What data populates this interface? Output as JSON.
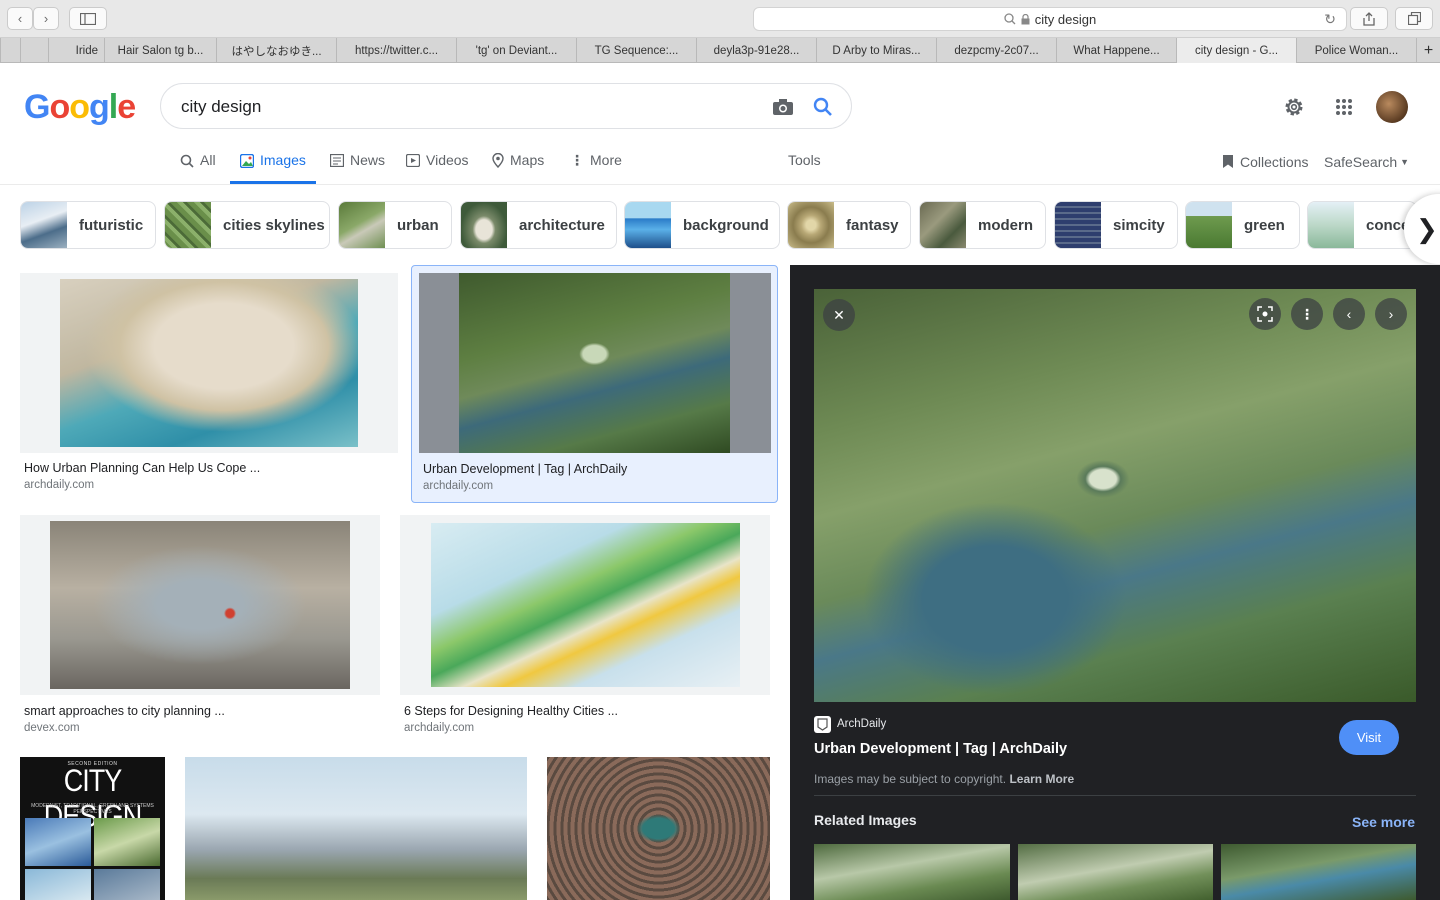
{
  "browser": {
    "address": "city design",
    "tabs": [
      "Iride",
      "Hair Salon tg b...",
      "はやしなおゆき...",
      "https://twitter.c...",
      "'tg' on Deviant...",
      "TG Sequence:...",
      "deyla3p-91e28...",
      "D Arby to Miras...",
      "dezpcmy-2c07...",
      "What Happene...",
      "city design - G...",
      "Police Woman..."
    ],
    "active_tab": 10
  },
  "search": {
    "query": "city design"
  },
  "nav": {
    "tabs": [
      "All",
      "Images",
      "News",
      "Videos",
      "Maps",
      "More"
    ],
    "tools": "Tools",
    "collections": "Collections",
    "safesearch": "SafeSearch"
  },
  "chips": [
    "futuristic",
    "cities skylines",
    "urban",
    "architecture",
    "background",
    "fantasy",
    "modern",
    "simcity",
    "green",
    "conce"
  ],
  "results": [
    {
      "caption": "How Urban Planning Can Help Us Cope ...",
      "source": "archdaily.com"
    },
    {
      "caption": "Urban Development | Tag | ArchDaily",
      "source": "archdaily.com"
    },
    {
      "caption": "smart approaches to city planning ...",
      "source": "devex.com"
    },
    {
      "caption": "6 Steps for Designing Healthy Cities ...",
      "source": "archdaily.com"
    }
  ],
  "book": {
    "edition": "SECOND EDITION",
    "title": "CITY DESIGN",
    "subtitle": "MODERNIST, TRADITIONAL, GREEN AND SYSTEMS PERSPECTIVES"
  },
  "panel": {
    "site": "ArchDaily",
    "title": "Urban Development | Tag | ArchDaily",
    "visit": "Visit",
    "copyright": "Images may be subject to copyright.",
    "learn_more": "Learn More",
    "related": "Related Images",
    "see_more": "See more"
  },
  "colors": {
    "accent": "#1a73e8",
    "panel_bg": "#202124",
    "visit_btn": "#4f8ff7"
  }
}
